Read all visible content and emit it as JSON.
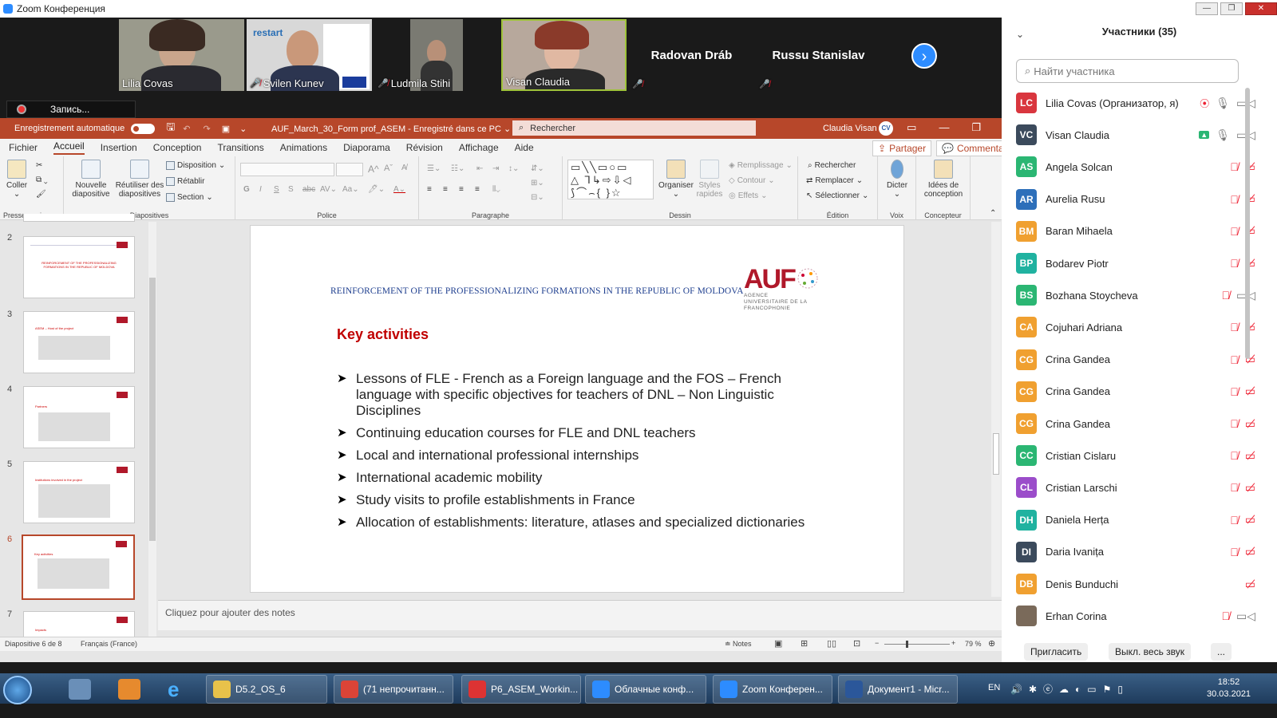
{
  "window": {
    "title": "Zoom Конференция"
  },
  "videos": [
    {
      "name": "Lilia Covas",
      "muted": false
    },
    {
      "name": "Svilen Kunev",
      "muted": true,
      "slide_logo": "restart"
    },
    {
      "name": "Ludmila Stihi",
      "muted": true
    },
    {
      "name": "Visan Claudia",
      "muted": false
    },
    {
      "name": "Radovan Dráb",
      "muted": true
    },
    {
      "name": "Russu Stanislav",
      "muted": true
    }
  ],
  "recording": {
    "label": "Запись..."
  },
  "ppt": {
    "autosave_label": "Enregistrement automatique",
    "doc_title": "AUF_March_30_Form prof_ASEM  -  Enregistré dans ce PC",
    "search_placeholder": "Rechercher",
    "user_name": "Claudia Visan",
    "user_initials": "CV",
    "tabs": [
      "Fichier",
      "Accueil",
      "Insertion",
      "Conception",
      "Transitions",
      "Animations",
      "Diaporama",
      "Révision",
      "Affichage",
      "Aide"
    ],
    "share_label": "Partager",
    "comments_label": "Commentaires",
    "ribbon": {
      "paste": "Coller",
      "clipboard_group": "Presse-papiers",
      "new_slide": "Nouvelle diapositive",
      "reuse_slides": "Réutiliser des diapositives",
      "layout": "Disposition",
      "reset": "Rétablir",
      "section": "Section",
      "slides_group": "Diapositives",
      "font_group": "Police",
      "paragraph_group": "Paragraphe",
      "arrange": "Organiser",
      "quick_styles": "Styles rapides",
      "fill": "Remplissage",
      "outline": "Contour",
      "effects": "Effets",
      "drawing_group": "Dessin",
      "find": "Rechercher",
      "replace": "Remplacer",
      "select": "Sélectionner",
      "editing_group": "Édition",
      "dictate": "Dicter",
      "voice_group": "Voix",
      "design_ideas": "Idées de conception",
      "designer_group": "Concepteur"
    },
    "thumbnails": [
      {
        "num": "2",
        "title": "REINFORCEMENT OF THE PROFESSIONALIZING FORMATIONS IN THE REPUBLIC OF MOLDOVA",
        "selected": false
      },
      {
        "num": "3",
        "title": "ASEM – Host of the project",
        "selected": false
      },
      {
        "num": "4",
        "title": "Partners",
        "selected": false
      },
      {
        "num": "5",
        "title": "Institutions involved in the project",
        "selected": false
      },
      {
        "num": "6",
        "title": "Key activities",
        "selected": true
      },
      {
        "num": "7",
        "title": "Impacts",
        "selected": false
      }
    ],
    "slide": {
      "header": "REINFORCEMENT OF THE PROFESSIONALIZING FORMATIONS IN THE REPUBLIC OF MOLDOVA",
      "logo_text": "AUF",
      "logo_sub": "AGENCE UNIVERSITAIRE DE LA FRANCOPHONIE",
      "title": "Key activities",
      "bullets": [
        "Lessons of FLE - French as a Foreign language and the FOS – French language with specific objectives for teachers of DNL – Non Linguistic Disciplines",
        "Continuing education courses for FLE and DNL teachers",
        "Local and international professional internships",
        "International academic mobility",
        "Study visits to profile establishments in France",
        "Allocation of establishments: literature, atlases and specialized dictionaries"
      ]
    },
    "notes_placeholder": "Cliquez pour ajouter des notes",
    "status": {
      "slide_pos": "Diapositive 6 de 8",
      "language": "Français (France)",
      "notes_btn": "Notes",
      "zoom": "79 %"
    }
  },
  "participants": {
    "header": "Участники (35)",
    "search_placeholder": "Найти участника",
    "list": [
      {
        "initials": "LC",
        "name": "Lilia Covas (Организатор, я)",
        "color": "#d9363e",
        "mic": "on",
        "cam": "on"
      },
      {
        "initials": "VC",
        "name": "Visan Claudia",
        "color": "#3b4a5c",
        "mic": "on",
        "cam": "on"
      },
      {
        "initials": "AS",
        "name": "Angela Solcan",
        "color": "#2bb673",
        "mic": "off",
        "cam": "off"
      },
      {
        "initials": "AR",
        "name": "Aurelia Rusu",
        "color": "#2d6fba",
        "mic": "off",
        "cam": "off"
      },
      {
        "initials": "BM",
        "name": "Baran Mihaela",
        "color": "#f0a030",
        "mic": "off",
        "cam": "off"
      },
      {
        "initials": "BP",
        "name": "Bodarev Piotr",
        "color": "#20b2a0",
        "mic": "off",
        "cam": "off"
      },
      {
        "initials": "BS",
        "name": "Bozhana Stoycheva",
        "color": "#2bb673",
        "mic": "off",
        "cam": "on"
      },
      {
        "initials": "CA",
        "name": "Cojuhari Adriana",
        "color": "#f0a030",
        "mic": "off",
        "cam": "off"
      },
      {
        "initials": "CG",
        "name": "Crina Gandea",
        "color": "#f0a030",
        "mic": "off",
        "cam": "off"
      },
      {
        "initials": "CG",
        "name": "Crina Gandea",
        "color": "#f0a030",
        "mic": "off",
        "cam": "off"
      },
      {
        "initials": "CG",
        "name": "Crina Gandea",
        "color": "#f0a030",
        "mic": "off",
        "cam": "off"
      },
      {
        "initials": "CC",
        "name": "Cristian Cislaru",
        "color": "#2bb673",
        "mic": "off",
        "cam": "off"
      },
      {
        "initials": "CL",
        "name": "Cristian Larschi",
        "color": "#9b4dca",
        "mic": "off",
        "cam": "off"
      },
      {
        "initials": "DH",
        "name": "Daniela Herța",
        "color": "#20b2a0",
        "mic": "off",
        "cam": "off"
      },
      {
        "initials": "DI",
        "name": "Daria Ivanița",
        "color": "#3b4a5c",
        "mic": "off",
        "cam": "off"
      },
      {
        "initials": "DB",
        "name": "Denis Bunduchi",
        "color": "#f0a030",
        "mic": "none",
        "cam": "off"
      },
      {
        "initials": "",
        "name": "Erhan Corina",
        "color": "#7a6a5a",
        "mic": "off",
        "cam": "on"
      }
    ],
    "invite": "Пригласить",
    "mute_all": "Выкл. весь звук",
    "more": "..."
  },
  "taskbar": {
    "items": [
      {
        "label": "D5.2_OS_6",
        "color": "#e8c24a"
      },
      {
        "label": "(71 непрочитанн...",
        "color": "#db4437"
      },
      {
        "label": "P6_ASEM_Workin...",
        "color": "#d33"
      },
      {
        "label": "Облачные конф...",
        "color": "#2d8cff"
      },
      {
        "label": "Zoom Конферен...",
        "color": "#2d8cff"
      },
      {
        "label": "Документ1 - Micr...",
        "color": "#2b579a"
      }
    ],
    "lang": "EN",
    "time": "18:52",
    "date": "30.03.2021"
  }
}
